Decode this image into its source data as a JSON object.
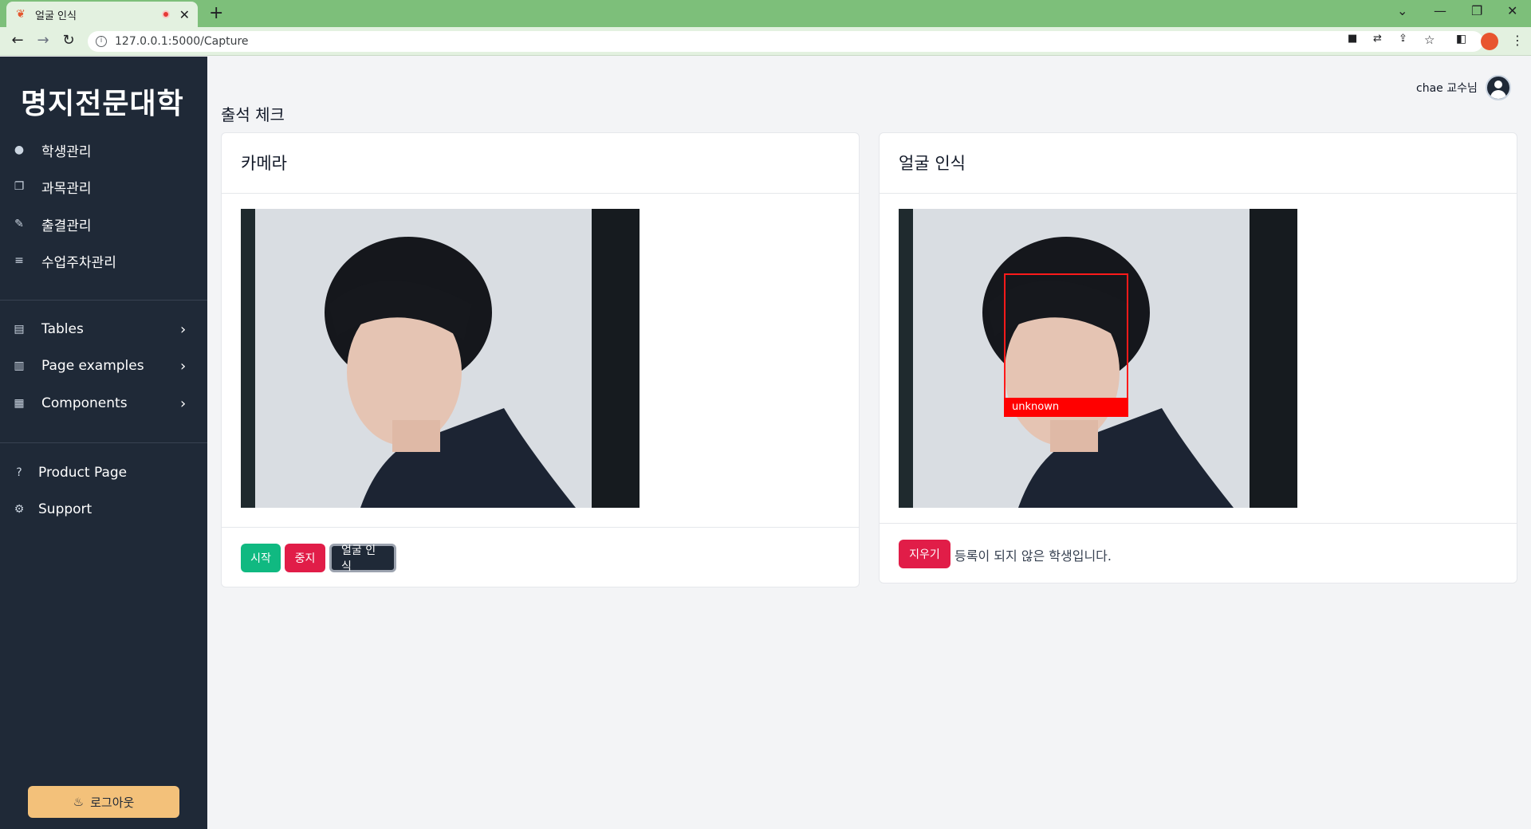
{
  "browser": {
    "tab_title": "얼굴 인식",
    "url": "127.0.0.1:5000/Capture",
    "new_tab": "+",
    "profile_initial": ""
  },
  "sidebar": {
    "brand": "명지전문대학",
    "menu": [
      {
        "label": "학생관리",
        "icon": "user-icon"
      },
      {
        "label": "과목관리",
        "icon": "copy-icon"
      },
      {
        "label": "출결관리",
        "icon": "edit-icon"
      },
      {
        "label": "수업주차관리",
        "icon": "list-icon"
      }
    ],
    "sections": [
      {
        "label": "Tables",
        "icon": "table-icon"
      },
      {
        "label": "Page examples",
        "icon": "pages-icon"
      },
      {
        "label": "Components",
        "icon": "archive-icon"
      }
    ],
    "extra": [
      {
        "label": "Product Page",
        "icon": "help-icon"
      },
      {
        "label": "Support",
        "icon": "gear-icon"
      }
    ],
    "logout": "로그아웃"
  },
  "header": {
    "user": "chae 교수님"
  },
  "main": {
    "page_title": "출석 체크",
    "camera_card": {
      "title": "카메라",
      "buttons": {
        "start": "시작",
        "stop": "중지",
        "recognize": "얼굴 인식"
      }
    },
    "recog_card": {
      "title": "얼굴 인식",
      "face_label": "unknown",
      "clear_button": "지우기",
      "message": "등록이 되지 않은 학생입니다."
    }
  },
  "colors": {
    "sidebar_bg": "#1f2937",
    "start": "#10b981",
    "stop": "#e11d48",
    "logout": "#f3c17a",
    "chrome": "#7dbf7a"
  }
}
